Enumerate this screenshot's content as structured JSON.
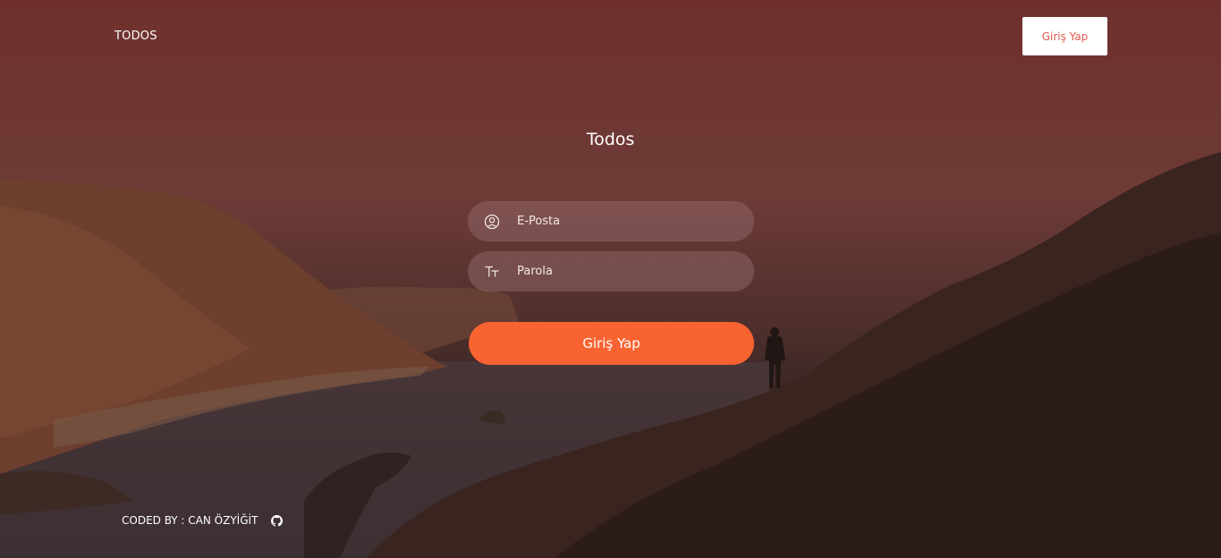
{
  "navbar": {
    "brand": "TODOS",
    "login_label": "Giriş Yap"
  },
  "form": {
    "title": "Todos",
    "email": {
      "placeholder": "E-Posta",
      "icon": "user-circle-icon"
    },
    "password": {
      "placeholder": "Parola",
      "icon": "text-size-icon"
    },
    "submit_label": "Giriş Yap"
  },
  "footer": {
    "credit": "CODED BY : CAN ÖZYİĞİT",
    "icon": "github-icon"
  },
  "colors": {
    "accent": "#f96332",
    "nav_button_text": "#e05a4c",
    "overlay_top": "#6f302c",
    "overlay_bottom": "#171313"
  }
}
